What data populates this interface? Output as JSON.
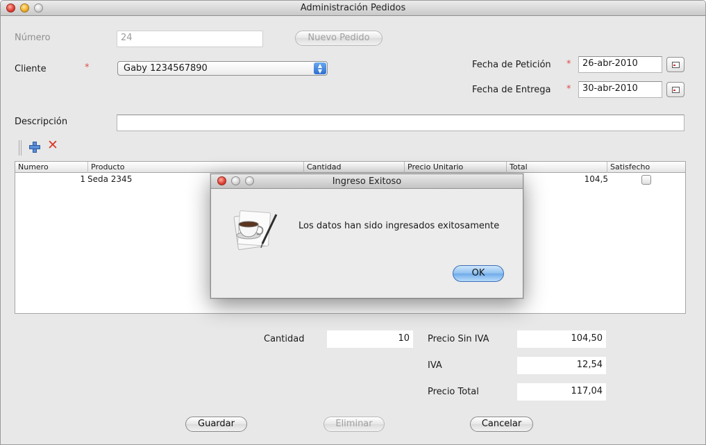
{
  "window": {
    "title": "Administración Pedidos"
  },
  "form": {
    "numero_label": "Número",
    "numero_value": "24",
    "nuevo_pedido_button": "Nuevo Pedido",
    "cliente_label": "Cliente",
    "required_mark": "*",
    "cliente_value": "Gaby 1234567890",
    "fecha_peticion_label": "Fecha de Petición",
    "fecha_peticion_value": "26-abr-2010",
    "fecha_entrega_label": "Fecha de Entrega",
    "fecha_entrega_value": "30-abr-2010",
    "descripcion_label": "Descripción",
    "descripcion_value": ""
  },
  "toolbar": {
    "add_icon": "plus-icon",
    "delete_icon": "x-icon"
  },
  "table": {
    "columns": [
      "Numero",
      "Producto",
      "Cantidad",
      "Precio Unitario",
      "Total",
      "Satisfecho"
    ],
    "rows": [
      {
        "numero": "1",
        "producto": "Seda 2345",
        "cantidad": "",
        "precio_unitario": "",
        "total": "104,5",
        "satisfecho": false
      }
    ]
  },
  "totals": {
    "cantidad_label": "Cantidad",
    "cantidad_value": "10",
    "precio_sin_iva_label": "Precio Sin IVA",
    "precio_sin_iva_value": "104,50",
    "iva_label": "IVA",
    "iva_value": "12,54",
    "precio_total_label": "Precio Total",
    "precio_total_value": "117,04"
  },
  "buttons": {
    "guardar": "Guardar",
    "eliminar": "Eliminar",
    "cancelar": "Cancelar"
  },
  "dialog": {
    "title": "Ingreso Exitoso",
    "message": "Los datos han sido ingresados exitosamente",
    "ok": "OK",
    "icon": "coffee-cup-icon"
  },
  "colors": {
    "required": "#e34a4a",
    "delete": "#d93a2b",
    "add": "#5b8fd8",
    "default_button": "#8ec0f0"
  }
}
